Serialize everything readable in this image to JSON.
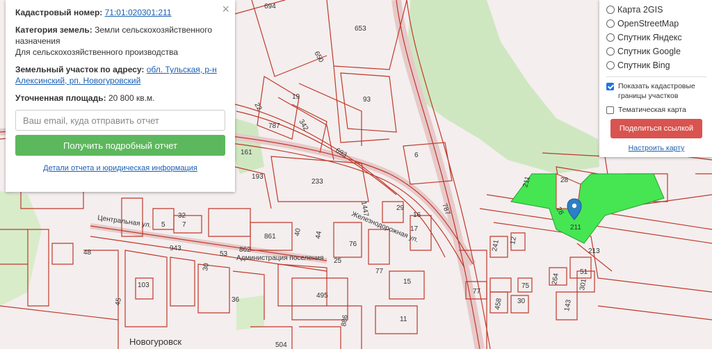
{
  "colors": {
    "parcel_line": "#c0392b",
    "selected_parcel": "#45e652",
    "pin": "#2c7fc4",
    "report_button": "#5cb85c",
    "share_button": "#d9534f"
  },
  "parcel_info": {
    "cadastral_label": "Кадастровый номер:",
    "cadastral_number": "71:01:020301:211",
    "category_label": "Категория земель:",
    "category_value": "Земли сельскохозяйственного назначения",
    "use_value": "Для сельскохозяйственного производства",
    "address_label": "Земельный участок по адресу:",
    "address_value": "обл. Тульская, р-н Алексинский, рп. Новогуровский",
    "area_label": "Уточненная площадь:",
    "area_value": "20 800 кв.м.",
    "email_placeholder": "Ваш email, куда отправить отчет",
    "report_button": "Получить подробный отчет",
    "details_link": "Детали отчета и юридическая информация",
    "close_icon": "×"
  },
  "layers": {
    "options": [
      "Карта 2GIS",
      "OpenStreetMap",
      "Спутник Яндекс",
      "Спутник Google",
      "Спутник Bing"
    ],
    "show_borders": "Показать кадастровые границы участков",
    "thematic": "Тематическая карта",
    "share_button": "Поделиться ссылкой",
    "setup_link": "Настроить карту"
  },
  "map_labels": {
    "l694": "694",
    "l653": "653",
    "l650": "650",
    "l93": "93",
    "l19": "19",
    "l22": "22",
    "l787": "787",
    "l342": "342",
    "l161": "161",
    "l693": "693",
    "l6": "6",
    "l233": "233",
    "l193": "193",
    "l28a": "28",
    "l28b": "28",
    "l211a": "211",
    "l211b": "211",
    "l787b": "787",
    "l1447": "1447",
    "l861": "861",
    "l862": "862",
    "l943": "943",
    "l48": "48",
    "l5": "5",
    "l7": "7",
    "l32": "32",
    "l77": "77",
    "l76": "76",
    "l12": "12",
    "l241": "241",
    "l213": "213",
    "l51": "51",
    "l264": "264",
    "l301": "301",
    "l75": "75",
    "l143": "143",
    "l458": "458",
    "l30": "30",
    "l77b": "77",
    "l495": "495",
    "l504": "504",
    "l886": "886",
    "l103": "103",
    "l45": "45",
    "l36": "36",
    "l40": "40",
    "l44": "44",
    "l25": "25",
    "l17": "17",
    "l29": "29",
    "l16": "16",
    "l15": "15",
    "l11": "11",
    "l53": "53",
    "l30b": "30",
    "street_central": "Центральная ул.",
    "street_rail": "Железнодорожная ул.",
    "admin": "Администрация поселения",
    "town": "Новогуровск"
  }
}
